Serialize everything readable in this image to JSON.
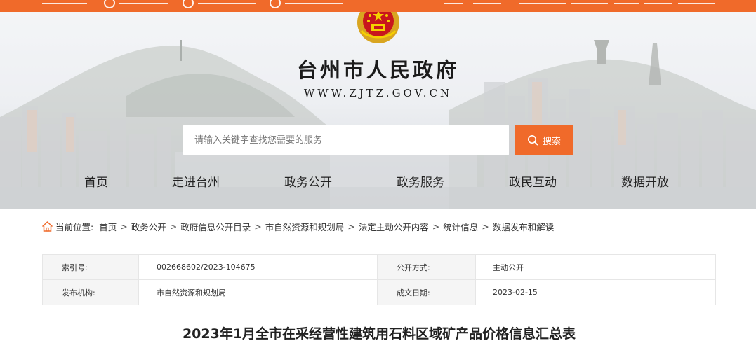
{
  "header": {
    "site_title": "台州市人民政府",
    "site_url": "WWW.ZJTZ.GOV.CN",
    "emblem_icon": "national-emblem-icon"
  },
  "search": {
    "placeholder": "请输入关键字查找您需要的服务",
    "button_label": "搜索",
    "icon": "search-icon"
  },
  "nav": {
    "items": [
      {
        "label": "首页"
      },
      {
        "label": "走进台州"
      },
      {
        "label": "政务公开"
      },
      {
        "label": "政务服务"
      },
      {
        "label": "政民互动"
      },
      {
        "label": "数据开放"
      }
    ]
  },
  "breadcrumb": {
    "icon": "home-icon",
    "prefix": "当前位置:",
    "items": [
      "首页",
      "政务公开",
      "政府信息公开目录",
      "市自然资源和规划局",
      "法定主动公开内容",
      "统计信息",
      "数据发布和解读"
    ],
    "separator": ">"
  },
  "info_table": {
    "index_label": "索引号:",
    "index_value": "002668602/2023-104675",
    "open_method_label": "公开方式:",
    "open_method_value": "主动公开",
    "publisher_label": "发布机构:",
    "publisher_value": "市自然资源和规划局",
    "date_label": "成文日期:",
    "date_value": "2023-02-15"
  },
  "document": {
    "title": "2023年1月全市在采经营性建筑用石料区域矿产品价格信息汇总表"
  },
  "colors": {
    "accent": "#f06a2a",
    "table_key_bg": "#f5f5f5"
  }
}
